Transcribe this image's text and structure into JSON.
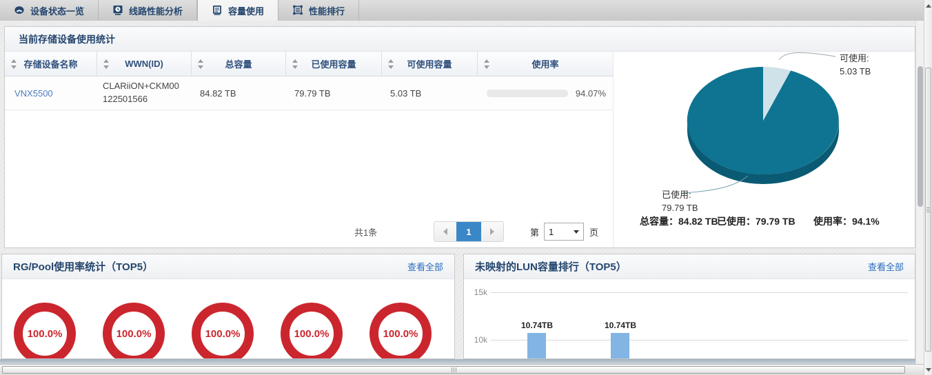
{
  "colors": {
    "navy": "#24466e",
    "teal": "#0e7492",
    "teal-dark": "#0a5a73",
    "teal-light": "#cfe1e9",
    "green": "#54b21f",
    "red": "#cb262e",
    "bar-blue": "#82b4e4",
    "link-blue": "#2a6dbd",
    "page-active": "#3a87c8"
  },
  "tabbar": {
    "tabs": [
      {
        "label": "设备状态一览",
        "active": false
      },
      {
        "label": "线路性能分析",
        "active": false
      },
      {
        "label": "容量使用",
        "active": true
      },
      {
        "label": "性能排行",
        "active": false
      }
    ]
  },
  "storage_panel": {
    "title": "当前存储设备使用统计",
    "table": {
      "columns": [
        "存储设备名称",
        "WWN(ID)",
        "总容量",
        "已使用容量",
        "可使用容量",
        "使用率"
      ],
      "row": {
        "name": "VNX5500",
        "wwn": "CLARiiON+CKM00122501566",
        "total": "84.82 TB",
        "used": "79.79 TB",
        "available": "5.03 TB",
        "usage_percent": "94.07%",
        "usage_value": 94.07
      }
    },
    "pagination": {
      "total_label": "共1条",
      "current_page": "1",
      "page_prefix": "第",
      "page_select_value": "1",
      "page_suffix": "页"
    },
    "pie_chart": {
      "type": "pie",
      "title": "",
      "slices": [
        {
          "label": "已使用",
          "value_tb": 79.79,
          "color": "#0e7492"
        },
        {
          "label": "可使用",
          "value_tb": 5.03,
          "color": "#cfe1e9"
        }
      ],
      "callouts": {
        "available": {
          "line1": "可使用:",
          "line2": "5.03 TB"
        },
        "used": {
          "line1": "已使用:",
          "line2": "79.79 TB"
        }
      },
      "summary": {
        "total": "总容量：84.82 TB",
        "used": "已使用：79.79 TB",
        "usage": "使用率：94.1%"
      }
    }
  },
  "rg_pool_panel": {
    "title": "RG/Pool使用率统计（TOP5）",
    "view_all_label": "查看全部",
    "chart_type": "donut-gauges",
    "gauges": [
      {
        "label": "100.0%",
        "value": 100.0
      },
      {
        "label": "100.0%",
        "value": 100.0
      },
      {
        "label": "100.0%",
        "value": 100.0
      },
      {
        "label": "100.0%",
        "value": 100.0
      },
      {
        "label": "100.0%",
        "value": 100.0
      }
    ]
  },
  "lun_panel": {
    "title": "未映射的LUN容量排行（TOP5）",
    "view_all_label": "查看全部",
    "chart": {
      "type": "bar",
      "y_ticks": [
        "15k",
        "10k"
      ],
      "bars": [
        {
          "label": "10.74TB",
          "value": 10740
        },
        {
          "label": "10.74TB",
          "value": 10740
        }
      ]
    }
  }
}
